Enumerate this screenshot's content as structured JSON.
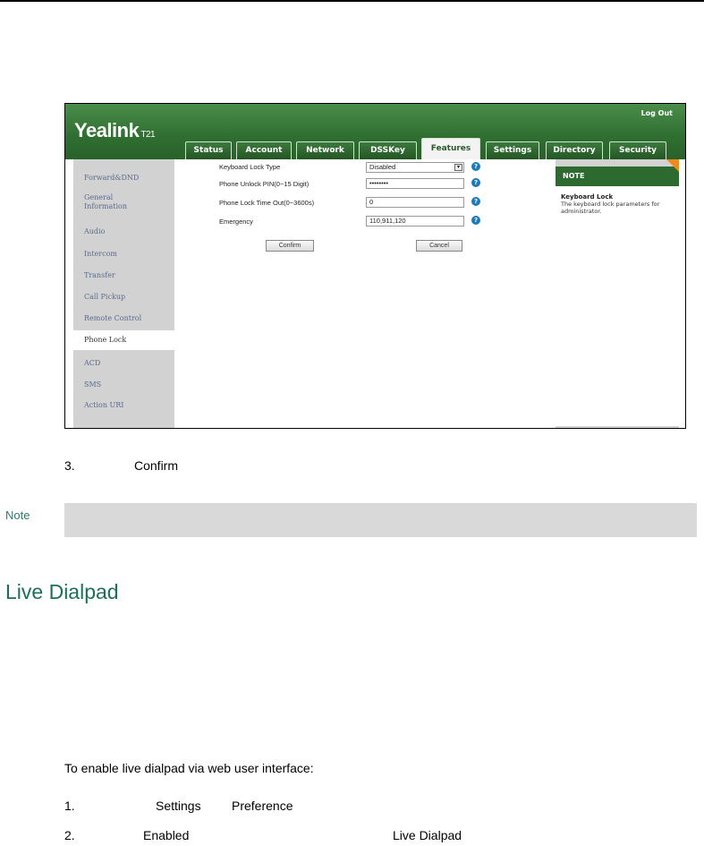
{
  "screenshot": {
    "brand": "Yealink",
    "model": "T21",
    "logout": "Log Out",
    "tabs": [
      "Status",
      "Account",
      "Network",
      "DSSKey",
      "Features",
      "Settings",
      "Directory",
      "Security"
    ],
    "active_tab": "Features",
    "sidebar": [
      "Forward&DND",
      "General Information",
      "Audio",
      "Intercom",
      "Transfer",
      "Call Pickup",
      "Remote Control",
      "Phone Lock",
      "ACD",
      "SMS",
      "Action URI"
    ],
    "active_sidebar": "Phone Lock",
    "fields": {
      "keyboard_lock_type": {
        "label": "Keyboard Lock Type",
        "value": "Disabled"
      },
      "unlock_pin": {
        "label": "Phone Unlock PIN(0~15 Digit)",
        "value": "••••••••"
      },
      "lock_timeout": {
        "label": "Phone Lock Time Out(0~3600s)",
        "value": "0"
      },
      "emergency": {
        "label": "Emergency",
        "value": "110,911,120"
      }
    },
    "buttons": {
      "confirm": "Confirm",
      "cancel": "Cancel"
    },
    "note": {
      "header": "NOTE",
      "title": "Keyboard Lock",
      "text": "The keyboard lock parameters for administrator."
    }
  },
  "doc": {
    "step3_num": "3.",
    "step3_word": "Confirm",
    "note_label": "Note",
    "heading": "Live Dialpad",
    "instruction": "To enable live dialpad via web user interface:",
    "step1_num": "1.",
    "step1_a": "Settings",
    "step1_b": "Preference",
    "step2_num": "2.",
    "step2_a": "Enabled",
    "step2_b": "Live Dialpad"
  }
}
